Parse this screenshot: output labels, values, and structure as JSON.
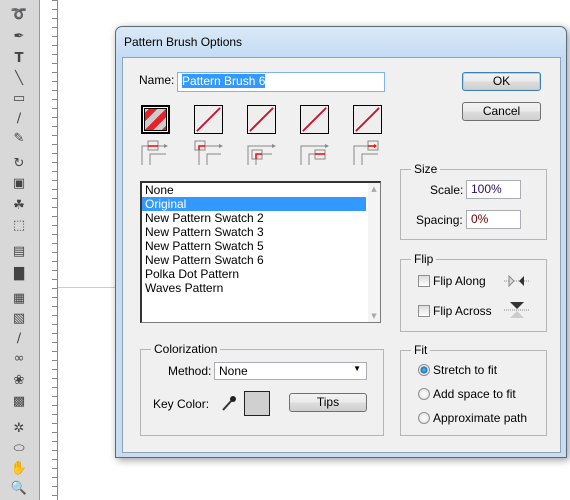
{
  "dialog": {
    "title": "Pattern Brush Options"
  },
  "name_field": {
    "label": "Name:",
    "value": "Pattern Brush 6"
  },
  "buttons": {
    "ok": "OK",
    "cancel": "Cancel",
    "tips": "Tips"
  },
  "tiles": [
    {
      "name": "side-tile",
      "selected": true
    },
    {
      "name": "outer-corner-tile",
      "selected": false
    },
    {
      "name": "inner-corner-tile",
      "selected": false
    },
    {
      "name": "start-tile",
      "selected": false
    },
    {
      "name": "end-tile",
      "selected": false
    }
  ],
  "pattern_list": {
    "items": [
      "None",
      "Original",
      "New Pattern Swatch 2",
      "New Pattern Swatch 3",
      "New Pattern Swatch 5",
      "New Pattern Swatch 6",
      "Polka Dot Pattern",
      "Waves Pattern"
    ],
    "selected": "Original"
  },
  "size": {
    "title": "Size",
    "scale_label": "Scale:",
    "scale_value": "100%",
    "spacing_label": "Spacing:",
    "spacing_value": "0%"
  },
  "flip": {
    "title": "Flip",
    "along_label": "Flip Along",
    "along_checked": false,
    "across_label": "Flip Across",
    "across_checked": false
  },
  "fit": {
    "title": "Fit",
    "options": [
      "Stretch to fit",
      "Add space to fit",
      "Approximate path"
    ],
    "selected": "Stretch to fit"
  },
  "colorization": {
    "title": "Colorization",
    "method_label": "Method:",
    "method_value": "None",
    "key_color_label": "Key Color:",
    "key_color": "#d0d0d0"
  },
  "colors": {
    "accent": "#3399ff",
    "tile_red": "#e0102a",
    "title_bar": "#c4dcf3"
  }
}
